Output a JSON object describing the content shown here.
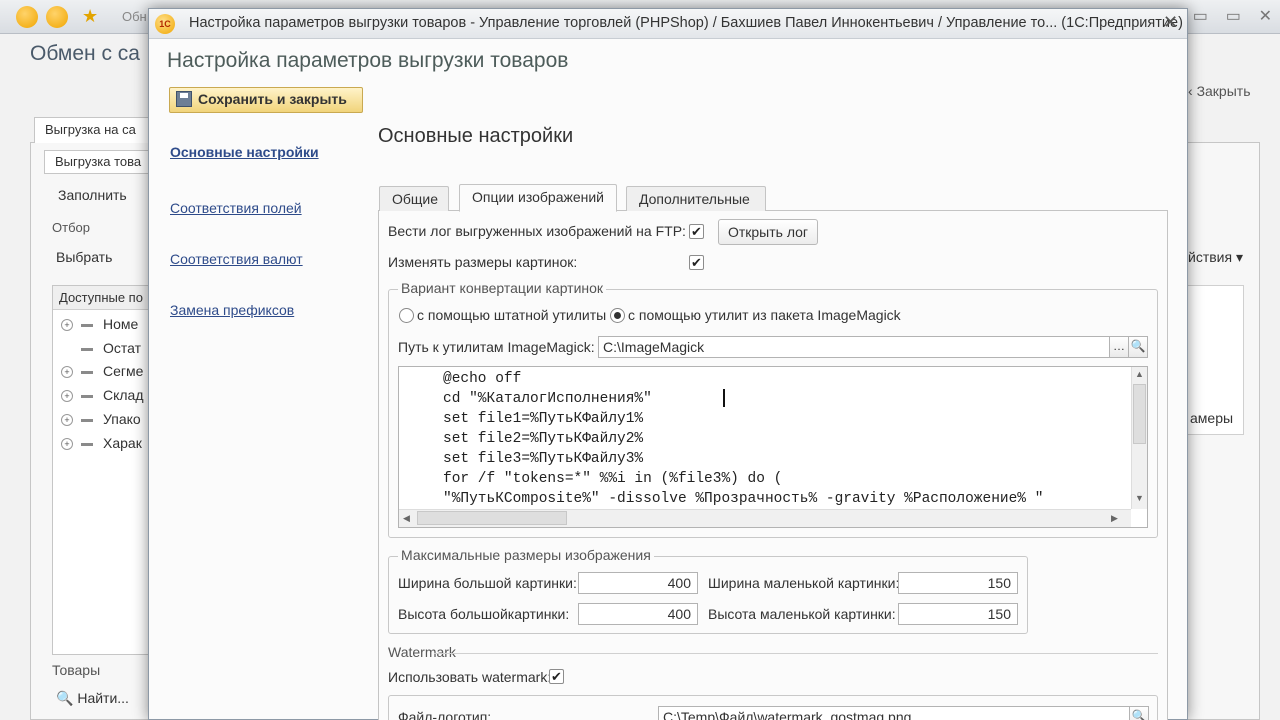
{
  "background": {
    "title_tail": "Обн",
    "heading": "Обмен с са",
    "close_label": "Закрыть",
    "tab_outer": "Выгрузка на са",
    "tab_inner": "Выгрузка това",
    "fill_button": "Заполнить",
    "otbor_label": "Отбор",
    "select_button": "Выбрать",
    "list_header": "Доступные по",
    "list_items": [
      "Номе",
      "Остат",
      "Сегме",
      "Склад",
      "Упако",
      "Харак"
    ],
    "actions_label": "йствия ▾",
    "right_cell": "амеры",
    "goods_label": "Товары",
    "find_button": "Найти..."
  },
  "dialog": {
    "window_title": "Настройка параметров выгрузки товаров - Управление торговлей (PHPShop) / Бахшиев Павел Иннокентьевич /  Управление то...  (1С:Предприятие)",
    "logo_text": "1С",
    "heading": "Настройка параметров выгрузки товаров",
    "save_close_button": "Сохранить и закрыть",
    "nav": [
      {
        "label": "Основные настройки",
        "active": true
      },
      {
        "label": "Соответствия полей",
        "active": false
      },
      {
        "label": "Соответствия валют",
        "active": false
      },
      {
        "label": "Замена префиксов",
        "active": false
      }
    ],
    "section_title": "Основные настройки",
    "tabs": [
      {
        "label": "Общие",
        "active": false
      },
      {
        "label": "Опции изображений",
        "active": true
      },
      {
        "label": "Дополнительные",
        "active": false
      }
    ],
    "ftp_log_label": "Вести лог выгруженных изображений на FTP:",
    "ftp_log_checked": true,
    "open_log_button": "Открыть лог",
    "resize_label": "Изменять размеры картинок:",
    "resize_checked": true,
    "convert_group": {
      "title": "Вариант конвертации картинок",
      "option_builtin": "с помощью штатной утилиты",
      "option_imagemagick": "с помощью утилит из пакета ImageMagick",
      "selected": "imagemagick",
      "path_label": "Путь к утилитам ImageMagick:",
      "path_value": "C:\\ImageMagick",
      "script_lines": [
        "@echo off",
        "cd \"%КаталогИсполнения%\"",
        "set file1=%ПутьКФайлу1%",
        "set file2=%ПутьКФайлу2%",
        "set file3=%ПутьКФайлу3%",
        "for /f \"tokens=*\" %%i in (%file3%) do (",
        "\"%ПутьКComposite%\" -dissolve %Прозрачность% -gravity %Расположение% \""
      ]
    },
    "sizes_group": {
      "title": "Максимальные размеры изображения",
      "big_width_label": "Ширина большой картинки:",
      "big_width_value": "400",
      "big_height_label": "Высота большойкартинки:",
      "big_height_value": "400",
      "small_width_label": "Ширина маленькой картинки:",
      "small_width_value": "150",
      "small_height_label": "Высота маленькой картинки:",
      "small_height_value": "150"
    },
    "watermark": {
      "title": "Watermark",
      "use_label": "Использовать watermark:",
      "use_checked": true,
      "logo_file_label": "Файл-логотип:",
      "logo_file_value": "C:\\Temp\\Файл\\watermark_gostmag.png"
    }
  }
}
